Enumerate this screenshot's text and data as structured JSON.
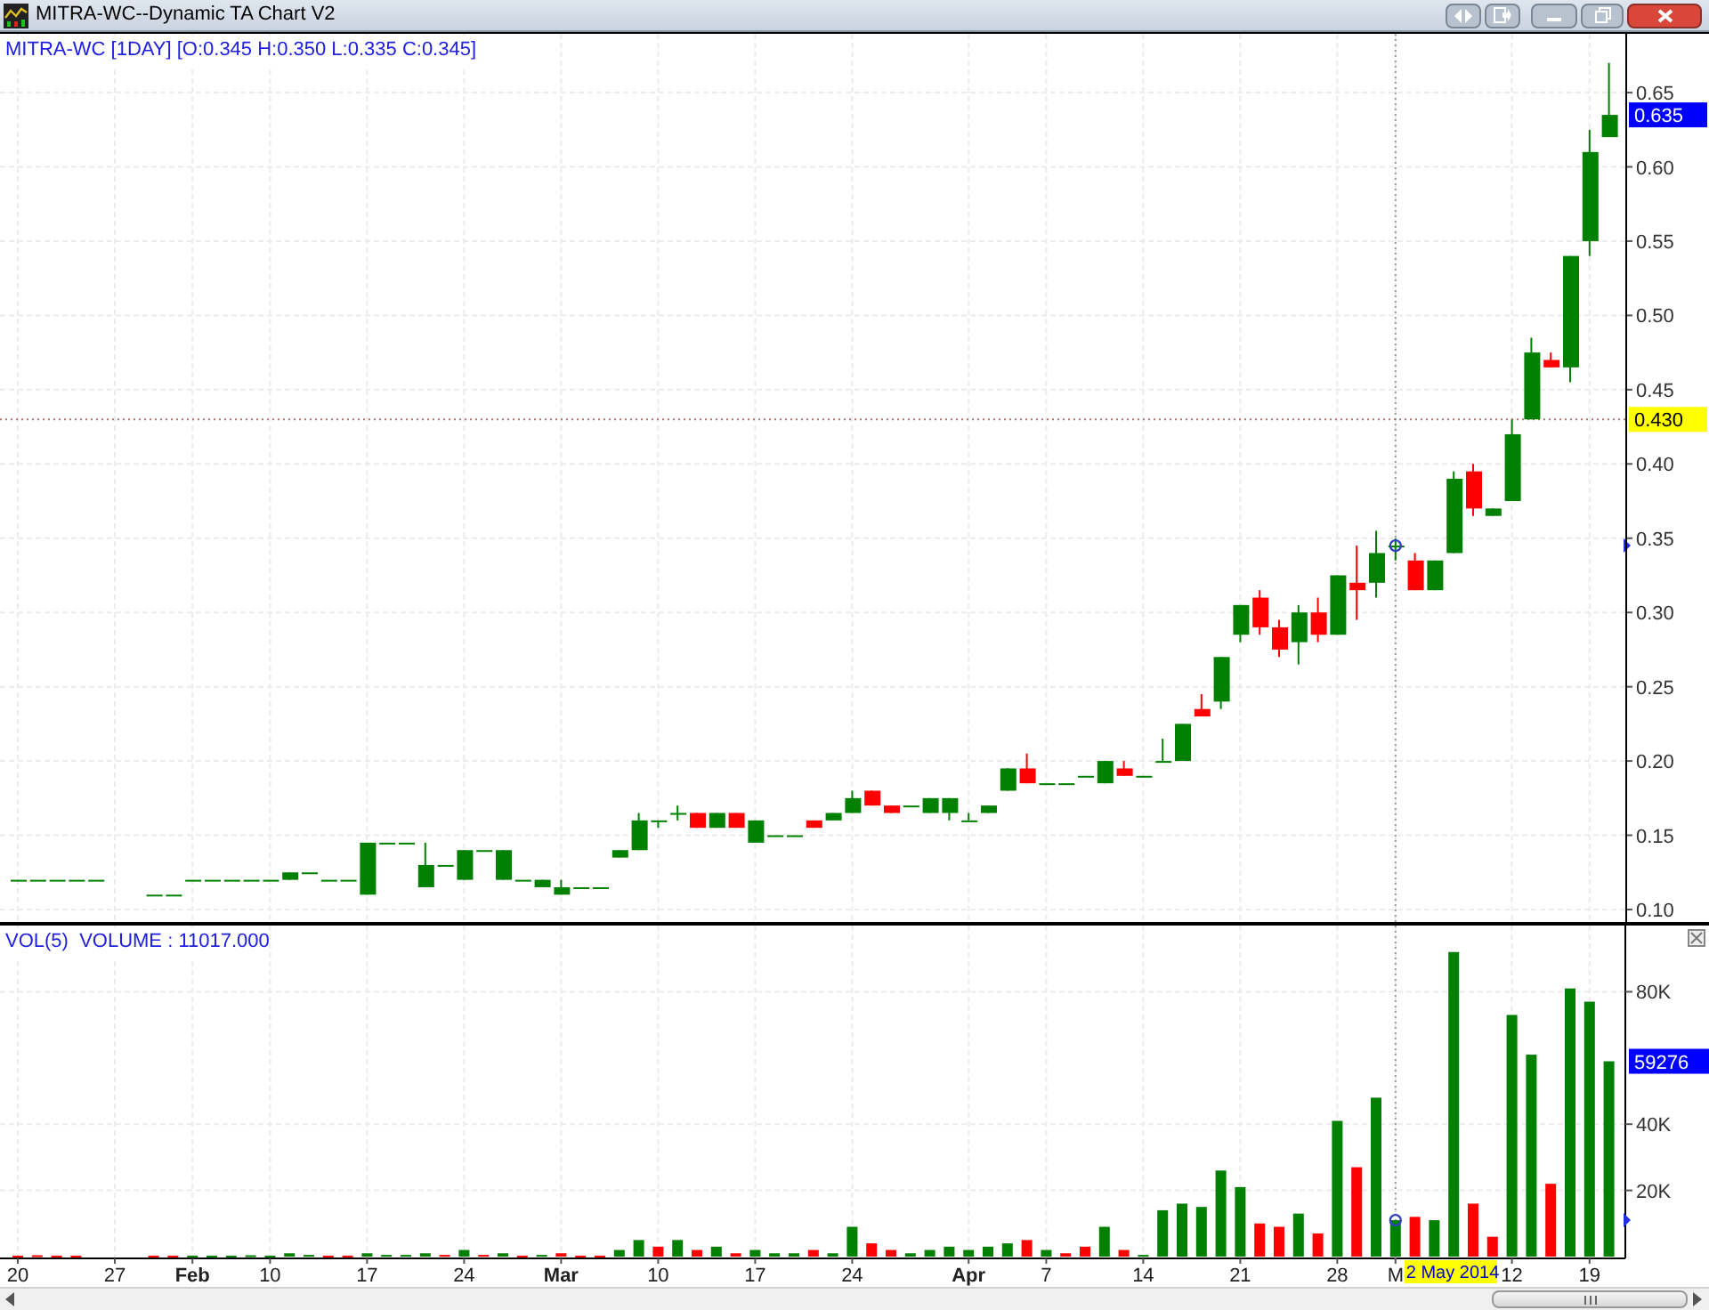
{
  "window": {
    "title": "MITRA-WC--Dynamic TA Chart V2"
  },
  "price_panel": {
    "legend": "MITRA-WC [1DAY] [O:0.345 H:0.350 L:0.335 C:0.345]",
    "y_axis_labels": [
      "0.65",
      "0.60",
      "0.55",
      "0.50",
      "0.45",
      "0.40",
      "0.35",
      "0.30",
      "0.25",
      "0.20",
      "0.15",
      "0.10"
    ],
    "last_price_badge": "0.635",
    "crosshair_price_badge": "0.430"
  },
  "volume_panel": {
    "legend": "VOL(5)  VOLUME : 11017.000",
    "last_volume_badge": "59276",
    "crosshair_date": "2 May 2014",
    "chart_data": {
      "type": "bar",
      "stacked": true,
      "grid": true,
      "ylim": [
        0,
        100000
      ],
      "yticks": [
        {
          "value": 20000,
          "label": "20K"
        },
        {
          "value": 40000,
          "label": "40K"
        },
        {
          "value": 80000,
          "label": "80K"
        }
      ],
      "categories": [
        "20",
        null,
        null,
        null,
        null,
        "27",
        null,
        null,
        null,
        "Feb",
        null,
        null,
        null,
        "10",
        null,
        null,
        null,
        null,
        "17",
        null,
        null,
        null,
        null,
        "24",
        null,
        null,
        null,
        null,
        "Mar",
        null,
        null,
        null,
        null,
        "10",
        null,
        null,
        null,
        null,
        "17",
        null,
        null,
        null,
        null,
        "24",
        null,
        null,
        null,
        null,
        null,
        "Apr",
        null,
        null,
        null,
        "7",
        null,
        null,
        null,
        null,
        "14",
        null,
        null,
        null,
        null,
        "21",
        null,
        null,
        null,
        null,
        "28",
        null,
        null,
        "M",
        null,
        null,
        null,
        null,
        null,
        "12",
        null,
        null,
        null,
        "19",
        null
      ],
      "series": [
        {
          "color": "#008000",
          "values": [
            null,
            null,
            null,
            null,
            null,
            null,
            null,
            null,
            null,
            300,
            300,
            300,
            400,
            300,
            1000,
            500,
            null,
            null,
            1000,
            500,
            500,
            1000,
            null,
            2000,
            null,
            1000,
            null,
            500,
            null,
            null,
            null,
            2000,
            5000,
            null,
            5000,
            null,
            3000,
            null,
            2000,
            1000,
            1000,
            null,
            1000,
            9000,
            null,
            null,
            1000,
            2000,
            3000,
            2000,
            3000,
            4000,
            null,
            2000,
            null,
            null,
            9000,
            null,
            500,
            14000,
            16000,
            15000,
            26000,
            21000,
            null,
            null,
            13000,
            null,
            41000,
            null,
            48000,
            11000,
            null,
            11000,
            92000,
            null,
            null,
            73000,
            61000,
            null,
            81000,
            77000,
            59000
          ]
        },
        {
          "color": "#ff0000",
          "values": [
            300,
            400,
            300,
            300,
            null,
            null,
            null,
            300,
            300,
            null,
            null,
            null,
            null,
            null,
            null,
            null,
            300,
            300,
            null,
            null,
            null,
            null,
            500,
            null,
            500,
            null,
            300,
            null,
            1000,
            300,
            300,
            null,
            null,
            3000,
            null,
            2000,
            null,
            1000,
            null,
            null,
            null,
            2000,
            null,
            null,
            4000,
            2000,
            null,
            null,
            null,
            null,
            null,
            null,
            5000,
            null,
            1000,
            3000,
            null,
            2000,
            null,
            null,
            null,
            null,
            null,
            null,
            10000,
            9000,
            null,
            7000,
            null,
            27000,
            null,
            null,
            12000,
            null,
            null,
            16000,
            6000,
            null,
            null,
            22000,
            null,
            null,
            null
          ]
        }
      ]
    }
  }
}
